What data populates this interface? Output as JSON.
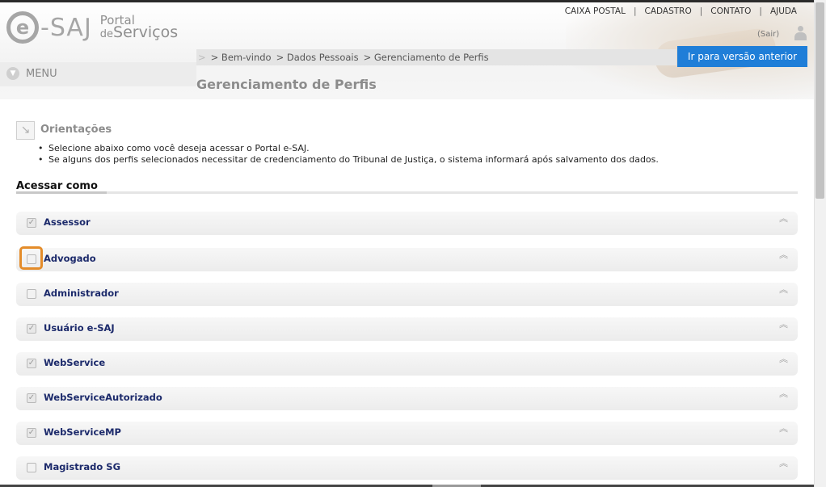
{
  "header": {
    "logo": {
      "e": "e",
      "saj": "-SAJ",
      "portal": "Portal",
      "de": "de",
      "servicos": "Serviços"
    },
    "nav": [
      "CAIXA POSTAL",
      "CADASTRO",
      "CONTATO",
      "AJUDA"
    ],
    "nav_separator": "|",
    "logout": "(Sair)",
    "menu": "MENU",
    "breadcrumb": [
      "> Bem-vindo",
      "> Dados Pessoais",
      "> Gerenciamento de Perfis"
    ],
    "previous_version_button": "Ir para versão anterior"
  },
  "page": {
    "title": "Gerenciamento de Perfis",
    "orientations": {
      "title": "Orientações",
      "items": [
        "Selecione abaixo como você deseja acessar o Portal e-SAJ.",
        "Se alguns dos perfis selecionados necessitar de credenciamento do Tribunal de Justiça, o sistema informará após salvamento dos dados."
      ]
    },
    "section_title": "Acessar como",
    "profiles": [
      {
        "label": "Assessor",
        "checked": true,
        "check_glyph": "✓"
      },
      {
        "label": "Advogado",
        "checked": false,
        "check_glyph": ""
      },
      {
        "label": "Administrador",
        "checked": false,
        "check_glyph": ""
      },
      {
        "label": "Usuário e-SAJ",
        "checked": true,
        "check_glyph": "✓"
      },
      {
        "label": "WebService",
        "checked": true,
        "check_glyph": "✓"
      },
      {
        "label": "WebServiceAutorizado",
        "checked": true,
        "check_glyph": "✓"
      },
      {
        "label": "WebServiceMP",
        "checked": true,
        "check_glyph": "✓"
      },
      {
        "label": "Magistrado SG",
        "checked": false,
        "check_glyph": ""
      }
    ],
    "collapse_glyph": "︽"
  },
  "icons": {
    "menu_chevron": "chevron-down-icon",
    "orientations": "arrow-down-right-icon",
    "user": "user-icon",
    "collapse": "double-chevron-up-icon"
  },
  "colors": {
    "accent_button": "#1f7ed8",
    "profile_label": "#1c2a6b",
    "highlight": "#e48c2a"
  }
}
